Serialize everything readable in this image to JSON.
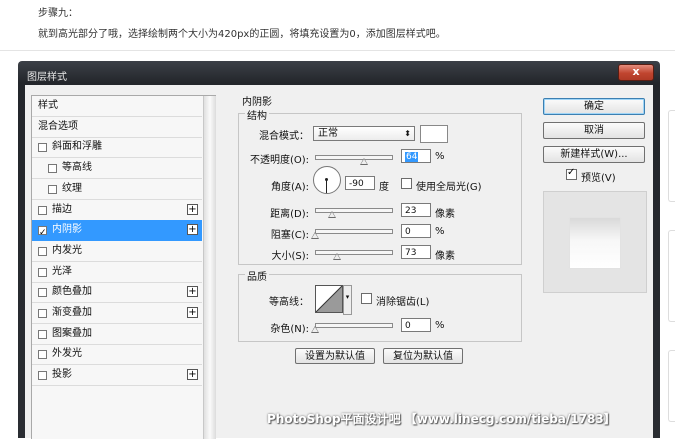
{
  "article": {
    "step": "步骤九：",
    "text": "就到高光部分了哦，选择绘制两个大小为420px的正圆，将填充设置为0，添加图层样式吧。"
  },
  "dialog": {
    "title": "图层样式",
    "close": "x",
    "left_header": "样式",
    "left_items": [
      {
        "label": "混合选项",
        "checkbox": false,
        "checked": false,
        "plus": false,
        "indent": 0,
        "selected": false
      },
      {
        "label": "斜面和浮雕",
        "checkbox": true,
        "checked": false,
        "plus": false,
        "indent": 0,
        "selected": false
      },
      {
        "label": "等高线",
        "checkbox": true,
        "checked": false,
        "plus": false,
        "indent": 1,
        "selected": false
      },
      {
        "label": "纹理",
        "checkbox": true,
        "checked": false,
        "plus": false,
        "indent": 1,
        "selected": false
      },
      {
        "label": "描边",
        "checkbox": true,
        "checked": false,
        "plus": true,
        "indent": 0,
        "selected": false
      },
      {
        "label": "内阴影",
        "checkbox": true,
        "checked": true,
        "plus": true,
        "indent": 0,
        "selected": true
      },
      {
        "label": "内发光",
        "checkbox": true,
        "checked": false,
        "plus": false,
        "indent": 0,
        "selected": false
      },
      {
        "label": "光泽",
        "checkbox": true,
        "checked": false,
        "plus": false,
        "indent": 0,
        "selected": false
      },
      {
        "label": "颜色叠加",
        "checkbox": true,
        "checked": false,
        "plus": true,
        "indent": 0,
        "selected": false
      },
      {
        "label": "渐变叠加",
        "checkbox": true,
        "checked": false,
        "plus": true,
        "indent": 0,
        "selected": false
      },
      {
        "label": "图案叠加",
        "checkbox": true,
        "checked": false,
        "plus": false,
        "indent": 0,
        "selected": false
      },
      {
        "label": "外发光",
        "checkbox": true,
        "checked": false,
        "plus": false,
        "indent": 0,
        "selected": false
      },
      {
        "label": "投影",
        "checkbox": true,
        "checked": false,
        "plus": true,
        "indent": 0,
        "selected": false
      }
    ],
    "inner_shadow": {
      "title": "内阴影",
      "structure": {
        "title": "结构",
        "blend_mode_label": "混合模式：",
        "blend_mode_value": "正常",
        "opacity_label": "不透明度(O):",
        "opacity_value": "64",
        "opacity_unit": "%",
        "opacity_fraction": 0.64,
        "angle_label": "角度(A):",
        "angle_value": "-90",
        "angle_unit": "度",
        "global_light_label": "使用全局光(G)",
        "global_light_checked": false,
        "distance_label": "距离(D):",
        "distance_value": "23",
        "distance_unit": "像素",
        "distance_fraction": 0.23,
        "choke_label": "阻塞(C):",
        "choke_value": "0",
        "choke_unit": "%",
        "choke_fraction": 0,
        "size_label": "大小(S):",
        "size_value": "73",
        "size_unit": "像素",
        "size_fraction": 0.292
      },
      "quality": {
        "title": "品质",
        "contour_label": "等高线：",
        "antialias_label": "消除锯齿(L)",
        "antialias_checked": false,
        "noise_label": "杂色(N):",
        "noise_value": "0",
        "noise_unit": "%",
        "noise_fraction": 0
      },
      "set_default_label": "设置为默认值",
      "reset_default_label": "复位为默认值"
    },
    "buttons": {
      "ok": "确定",
      "cancel": "取消",
      "new_style": "新建样式(W)...",
      "preview_label": "预览(V)",
      "preview_checked": true
    }
  },
  "watermark": "PhotoShop平面设计吧 【www.linecg.com/tieba/1783】"
}
